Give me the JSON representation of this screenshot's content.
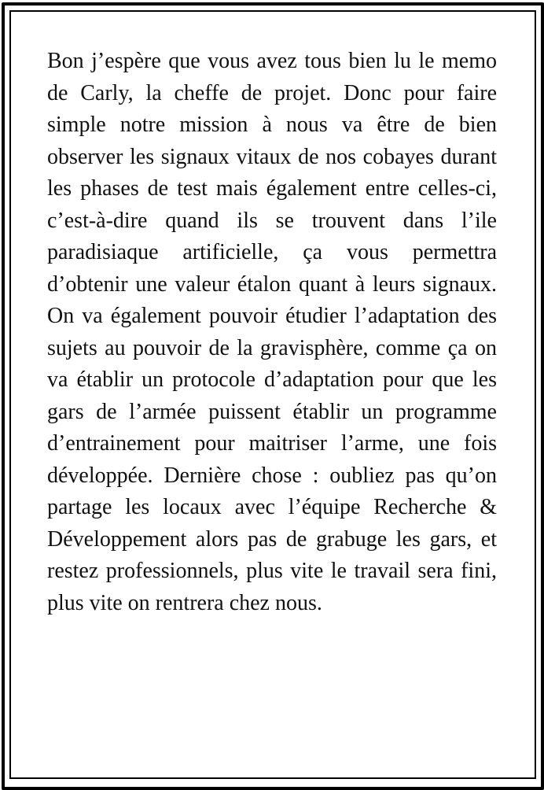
{
  "memo": {
    "text": "Bon j’espère que vous avez tous bien lu le memo de Carly, la cheffe de projet. Donc pour faire simple notre mission à nous va être de bien observer les signaux vitaux de nos cobayes durant les phases de test mais également entre celles-ci, c’est-à-dire quand ils se trouvent dans l’ile paradisiaque artificielle, ça vous permettra d’obtenir une valeur étalon quant à leurs signaux. On va également pouvoir étudier l’adaptation des sujets au pouvoir de la gravisphère, comme ça on va établir un protocole d’adaptation pour que les gars de l’armée puissent établir un programme d’entrainement pour maitriser l’arme, une fois développée. Dernière chose : oubliez pas qu’on partage les locaux avec l’équipe Recherche & Développement alors pas de grabuge les gars, et restez professionnels, plus vite le travail sera fini, plus vite on rentrera chez nous."
  },
  "colors": {
    "background": "#ffffff",
    "border": "#000000",
    "text": "#111111"
  }
}
